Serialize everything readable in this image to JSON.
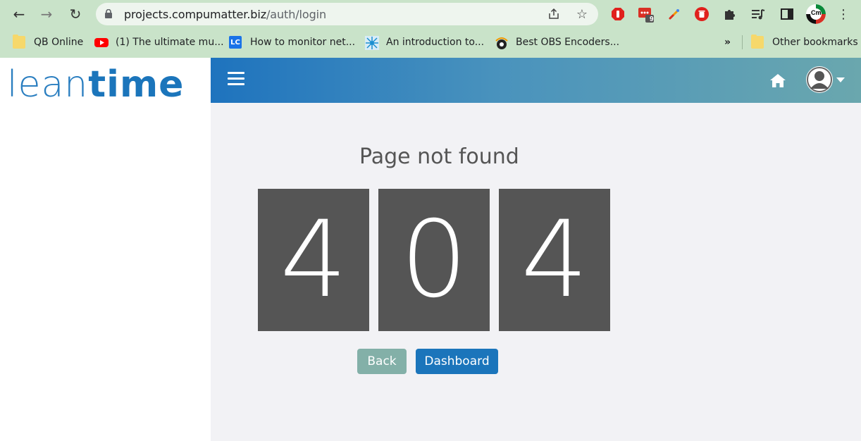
{
  "browser": {
    "url_host": "projects.compumatter.biz",
    "url_path": "/auth/login",
    "extension_badge": "9",
    "profile_initials": "Cm",
    "overflow": "»",
    "bookmarks": [
      {
        "label": "QB Online",
        "icon": "folder-icon"
      },
      {
        "label": "(1) The ultimate mu...",
        "icon": "youtube-icon"
      },
      {
        "label": "How to monitor net...",
        "icon": "lc-icon"
      },
      {
        "label": "An introduction to...",
        "icon": "network-icon"
      },
      {
        "label": "Best OBS Encoders...",
        "icon": "obs-icon"
      }
    ],
    "other_bookmarks": "Other bookmarks"
  },
  "app": {
    "logo_light": "lean",
    "logo_bold": "time",
    "page_title": "Page not found",
    "digits": [
      "4",
      "0",
      "4"
    ],
    "back_label": "Back",
    "dashboard_label": "Dashboard"
  },
  "colors": {
    "accent": "#1b75bb",
    "back_button": "#83b0a8",
    "digit_tile": "#555555",
    "chrome": "#c9e3c9"
  }
}
